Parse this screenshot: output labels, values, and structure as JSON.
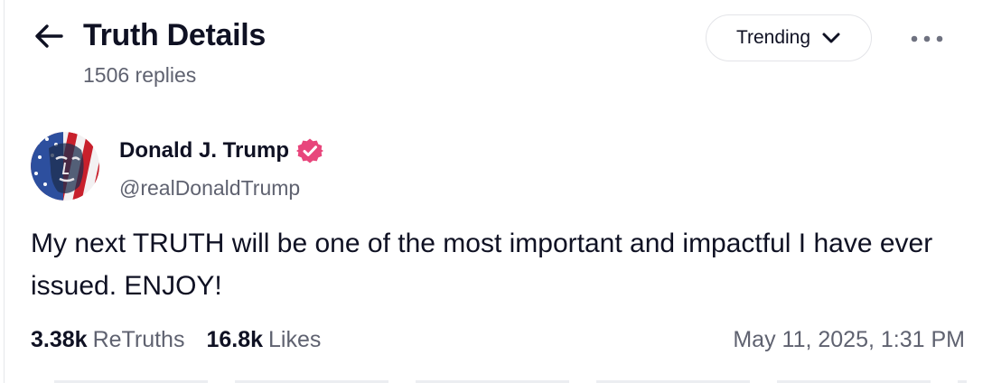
{
  "header": {
    "title": "Truth Details",
    "replies": "1506 replies",
    "sort_label": "Trending"
  },
  "post": {
    "author_name": "Donald J. Trump",
    "author_handle": "@realDonaldTrump",
    "verified_color": "#e8467c",
    "text": "My next TRUTH will be one of the most important and impactful I have ever issued. ENJOY!",
    "retruths_count": "3.38k",
    "retruths_label": "ReTruths",
    "likes_count": "16.8k",
    "likes_label": "Likes",
    "timestamp": "May 11, 2025, 1:31 PM"
  },
  "icons": {
    "back": "arrow-left-icon",
    "dropdown": "chevron-down-icon",
    "more": "more-horizontal-icon",
    "verified": "verified-badge-icon"
  }
}
